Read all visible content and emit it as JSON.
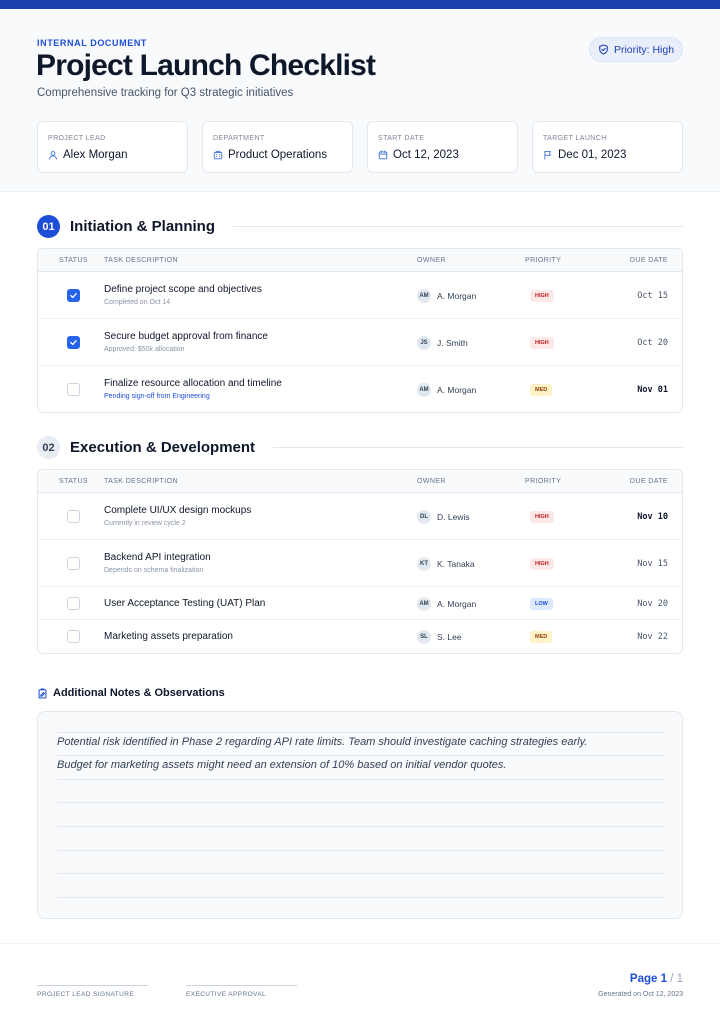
{
  "header": {
    "eyebrow": "INTERNAL DOCUMENT",
    "title": "Project Launch Checklist",
    "subtitle": "Comprehensive tracking for Q3 strategic initiatives",
    "priority": "Priority: High"
  },
  "meta": [
    {
      "label": "PROJECT LEAD",
      "value": "Alex Morgan",
      "icon": "user-icon"
    },
    {
      "label": "DEPARTMENT",
      "value": "Product Operations",
      "icon": "building-icon"
    },
    {
      "label": "START DATE",
      "value": "Oct 12, 2023",
      "icon": "calendar-icon"
    },
    {
      "label": "TARGET LAUNCH",
      "value": "Dec 01, 2023",
      "icon": "flag-icon"
    }
  ],
  "columns": {
    "status": "STATUS",
    "task": "TASK DESCRIPTION",
    "owner": "OWNER",
    "priority": "PRIORITY",
    "due": "DUE DATE"
  },
  "sections": [
    {
      "number": "01",
      "title": "Initiation & Planning",
      "rows": [
        {
          "checked": true,
          "title": "Define project scope and objectives",
          "sub": "Completed on Oct 14",
          "initials": "AM",
          "owner": "A. Morgan",
          "priority": "HIGH",
          "due": "Oct 15"
        },
        {
          "checked": true,
          "title": "Secure budget approval from finance",
          "sub": "Approved: $50k allocation",
          "initials": "JS",
          "owner": "J. Smith",
          "priority": "HIGH",
          "due": "Oct 20"
        },
        {
          "checked": false,
          "title": "Finalize resource allocation and timeline",
          "sub": "Pending sign-off from Engineering",
          "initials": "AM",
          "owner": "A. Morgan",
          "priority": "MED",
          "due": "Nov 01"
        }
      ]
    },
    {
      "number": "02",
      "title": "Execution & Development",
      "rows": [
        {
          "checked": false,
          "title": "Complete UI/UX design mockups",
          "sub": "Currently in review cycle 2",
          "initials": "DL",
          "owner": "D. Lewis",
          "priority": "HIGH",
          "due": "Nov 10"
        },
        {
          "checked": false,
          "title": "Backend API integration",
          "sub": "Depends on schema finalization",
          "initials": "KT",
          "owner": "K. Tanaka",
          "priority": "HIGH",
          "due": "Nov 15"
        },
        {
          "checked": false,
          "title": "User Acceptance Testing (UAT) Plan",
          "sub": "",
          "initials": "AM",
          "owner": "A. Morgan",
          "priority": "LOW",
          "due": "Nov 20"
        },
        {
          "checked": false,
          "title": "Marketing assets preparation",
          "sub": "",
          "initials": "SL",
          "owner": "S. Lee",
          "priority": "MED",
          "due": "Nov 22"
        }
      ]
    }
  ],
  "notes": {
    "title": "Additional Notes & Observations",
    "lines": [
      "Potential risk identified in Phase 2 regarding API rate limits. Team should investigate caching strategies early.",
      "Budget for marketing assets might need an extension of 10% based on initial vendor quotes."
    ]
  },
  "footer": {
    "sig1": "PROJECT LEAD SIGNATURE",
    "sig2": "EXECUTIVE APPROVAL",
    "page_label": "Page 1",
    "page_total": "/ 1",
    "generated": "Generated on Oct 12, 2023"
  },
  "colors": {
    "brand": "#1e40af",
    "accent": "#1d4ed8",
    "high": "#b91c1c",
    "med": "#92400e",
    "low": "#1d4ed8"
  }
}
